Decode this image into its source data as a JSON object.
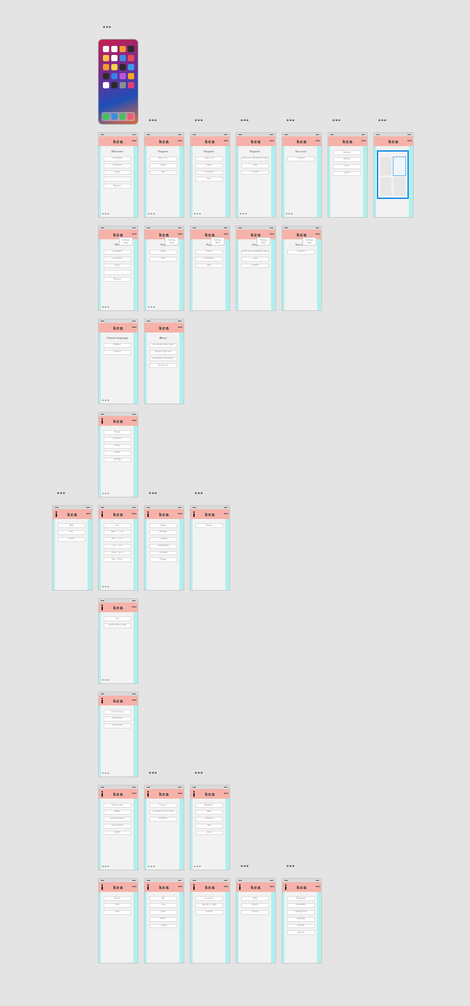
{
  "logo": "kea",
  "more": "•••",
  "pager": "• • •",
  "label_text": "•••",
  "phone": {
    "label": true
  },
  "rows": [
    {
      "artboards": [
        {
          "slot": 1,
          "label": false,
          "menu": false,
          "title": "Welcome",
          "items": [
            "Username",
            "Password",
            "Log in",
            "+",
            "Register"
          ],
          "pager": true,
          "popup": [],
          "highlighted": false
        },
        {
          "slot": 2,
          "label": true,
          "menu": false,
          "title": "Register",
          "items": [
            "Step 1 of 3",
            "Name",
            "Next"
          ],
          "pager": true,
          "popup": [],
          "highlighted": false
        },
        {
          "slot": 3,
          "label": true,
          "menu": false,
          "title": "Register",
          "items": [
            "Step 2 of 3",
            "Email",
            "Password",
            "Next"
          ],
          "pager": true,
          "popup": [],
          "highlighted": false
        },
        {
          "slot": 4,
          "label": true,
          "menu": false,
          "title": "Register",
          "items": [
            "Enter the confirmation code",
            "Code",
            "Confirm"
          ],
          "pager": true,
          "popup": [],
          "highlighted": false
        },
        {
          "slot": 5,
          "label": true,
          "menu": false,
          "title": "Success!",
          "items": [
            "Continue"
          ],
          "pager": true,
          "popup": [],
          "highlighted": false
        },
        {
          "slot": 6,
          "label": true,
          "menu": false,
          "title": "",
          "items": [
            "Camera",
            "Gallery",
            "Files",
            "Cancel"
          ],
          "pager": false,
          "popup": [],
          "highlighted": false
        },
        {
          "slot": 7,
          "label": true,
          "menu": false,
          "title": "",
          "items": [],
          "pager": false,
          "popup": [],
          "highlighted": true
        }
      ]
    },
    {
      "artboards": [
        {
          "slot": 1,
          "label": false,
          "menu": false,
          "title": "Wel",
          "items": [
            "Username",
            "Password",
            "Log in",
            "+",
            "Register"
          ],
          "pager": true,
          "popup": [
            "Settings",
            "Help"
          ],
          "highlighted": false
        },
        {
          "slot": 2,
          "label": false,
          "menu": false,
          "title": "Reg",
          "items": [
            "Name",
            "Next"
          ],
          "pager": true,
          "popup": [
            "Settings",
            "Help"
          ],
          "highlighted": false
        },
        {
          "slot": 3,
          "label": false,
          "menu": false,
          "title": "Reg",
          "items": [
            "Email",
            "Password",
            "Next"
          ],
          "pager": false,
          "popup": [
            "Settings",
            "Help"
          ],
          "highlighted": false
        },
        {
          "slot": 4,
          "label": false,
          "menu": false,
          "title": "Reg",
          "items": [
            "Enter the confirmation code",
            "Code",
            "Confirm"
          ],
          "pager": false,
          "popup": [
            "Settings",
            "Help"
          ],
          "highlighted": false
        },
        {
          "slot": 5,
          "label": false,
          "menu": false,
          "title": "Success!",
          "items": [
            "Continue"
          ],
          "pager": false,
          "popup": [
            "Settings",
            "Help"
          ],
          "highlighted": false
        }
      ]
    },
    {
      "artboards": [
        {
          "slot": 1,
          "label": false,
          "menu": false,
          "title": "Choose language",
          "items": [
            "English",
            "Deutsch"
          ],
          "pager": true,
          "popup": [],
          "highlighted": false
        },
        {
          "slot": 2,
          "label": false,
          "menu": false,
          "title": "About",
          "items": [
            "Kea shows where your",
            "group is right now",
            "and where it has been.",
            "Version 1.0"
          ],
          "pager": false,
          "popup": [],
          "highlighted": false
        }
      ]
    },
    {
      "artboards": [
        {
          "slot": 1,
          "label": false,
          "menu": true,
          "title": "",
          "items": [
            "Profile",
            "Locations",
            "Groups",
            "Events",
            "Settings"
          ],
          "pager": true,
          "popup": [],
          "highlighted": false
        }
      ]
    },
    {
      "artboards": [
        {
          "slot": 0,
          "label": true,
          "menu": true,
          "title": "",
          "items": [
            "Add",
            "Edit",
            "Delete"
          ],
          "pager": false,
          "popup": [],
          "highlighted": false
        },
        {
          "slot": 1,
          "label": false,
          "menu": true,
          "title": "",
          "items": [
            "Live",
            "Anna · 12:04",
            "Ben · 11:50",
            "Carl · 11:32",
            "Dana · 10:58",
            "Eva · 10:21"
          ],
          "pager": true,
          "popup": [],
          "highlighted": false
        },
        {
          "slot": 2,
          "label": true,
          "menu": true,
          "title": "",
          "items": [
            "Today",
            "Monday",
            "Tuesday",
            "Wednesday",
            "Thursday",
            "Friday"
          ],
          "pager": false,
          "popup": [],
          "highlighted": false
        },
        {
          "slot": 3,
          "label": true,
          "menu": true,
          "title": "",
          "items": [
            "Search"
          ],
          "pager": false,
          "popup": [],
          "highlighted": false
        }
      ]
    },
    {
      "artboards": [
        {
          "slot": 1,
          "label": false,
          "menu": true,
          "title": "",
          "items": [
            "Live",
            "Choose date & time"
          ],
          "pager": true,
          "popup": [],
          "highlighted": false
        }
      ]
    },
    {
      "artboards": [
        {
          "slot": 1,
          "label": false,
          "menu": true,
          "title": "",
          "items": [
            "Create Group",
            "Find Group",
            "Join Group"
          ],
          "pager": true,
          "popup": [],
          "highlighted": false
        }
      ]
    },
    {
      "artboards": [
        {
          "slot": 1,
          "label": false,
          "menu": true,
          "title": "",
          "items": [
            "Group name",
            "Admin",
            "Invite members",
            "Leave group",
            "Delete"
          ],
          "pager": true,
          "popup": [],
          "highlighted": false
        },
        {
          "slot": 2,
          "label": true,
          "menu": true,
          "title": "",
          "items": [
            "Group 1",
            "Locations of all 8 users",
            "Members"
          ],
          "pager": true,
          "popup": [],
          "highlighted": false
        },
        {
          "slot": 3,
          "label": true,
          "menu": true,
          "title": "",
          "items": [
            "Members",
            "Add",
            "Remove",
            "Edit",
            "Save"
          ],
          "pager": true,
          "popup": [],
          "highlighted": false
        }
      ]
    },
    {
      "artboards": [
        {
          "slot": 1,
          "label": false,
          "menu": true,
          "title": "",
          "items": [
            "Search",
            "Filter",
            "Save"
          ],
          "pager": false,
          "popup": [],
          "highlighted": false
        },
        {
          "slot": 2,
          "label": false,
          "menu": true,
          "title": "",
          "items": [
            "All",
            "Day",
            "Week",
            "Month",
            "Custom"
          ],
          "pager": false,
          "popup": [],
          "highlighted": false
        },
        {
          "slot": 3,
          "label": false,
          "menu": true,
          "title": "",
          "items": [
            "Locations",
            "Sign up & Login",
            "Contact"
          ],
          "pager": false,
          "popup": [],
          "highlighted": false
        },
        {
          "slot": 4,
          "label": true,
          "menu": true,
          "title": "",
          "items": [
            "Help",
            "Imprint",
            "Privacy"
          ],
          "pager": false,
          "popup": [],
          "highlighted": false
        },
        {
          "slot": 5,
          "label": true,
          "menu": true,
          "title": "",
          "items": [
            "Password",
            "Username",
            "Change Pass",
            "Language",
            "Settings",
            "Log out"
          ],
          "pager": false,
          "popup": [],
          "highlighted": false
        }
      ]
    }
  ]
}
